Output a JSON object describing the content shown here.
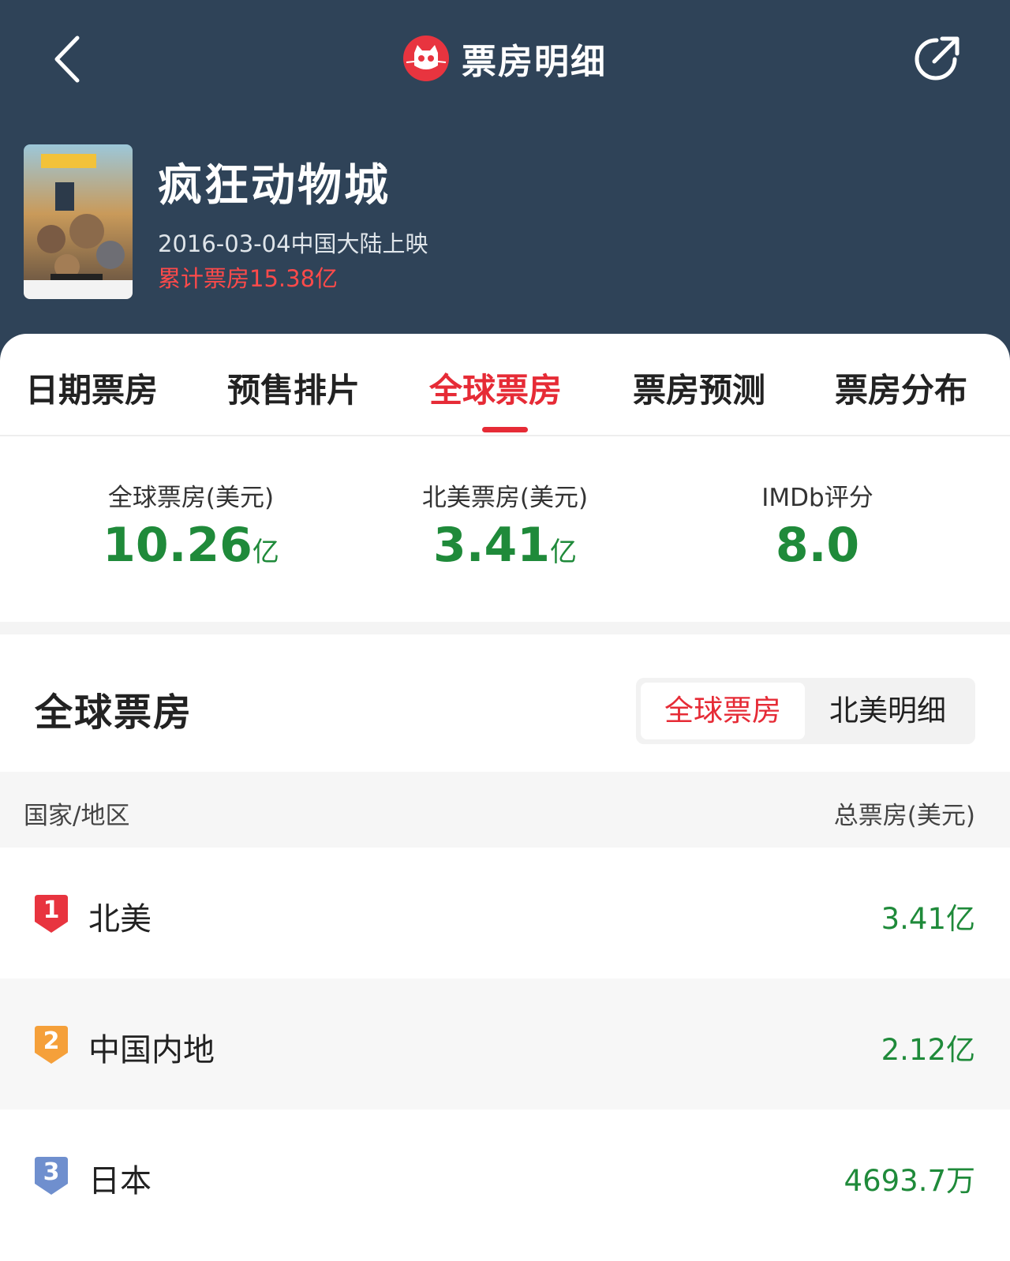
{
  "header": {
    "title": "票房明细",
    "movie_name": "疯狂动物城",
    "release_info": "2016-03-04中国大陆上映",
    "cumulative": "累计票房15.38亿"
  },
  "tabs": [
    {
      "label": "日期票房",
      "active": false
    },
    {
      "label": "预售排片",
      "active": false
    },
    {
      "label": "全球票房",
      "active": true
    },
    {
      "label": "票房预测",
      "active": false
    },
    {
      "label": "票房分布",
      "active": false
    }
  ],
  "stats": [
    {
      "label": "全球票房(美元)",
      "value": "10.26",
      "unit": "亿"
    },
    {
      "label": "北美票房(美元)",
      "value": "3.41",
      "unit": "亿"
    },
    {
      "label": "IMDb评分",
      "value": "8.0",
      "unit": ""
    }
  ],
  "section": {
    "title": "全球票房",
    "toggle_active": "全球票房",
    "toggle_other": "北美明细"
  },
  "table": {
    "col_region": "国家/地区",
    "col_total": "总票房(美元)",
    "rows": [
      {
        "rank": "1",
        "region": "北美",
        "amount": "3.41亿",
        "badge_color": "#e8343f"
      },
      {
        "rank": "2",
        "region": "中国内地",
        "amount": "2.12亿",
        "badge_color": "#f5a03a"
      },
      {
        "rank": "3",
        "region": "日本",
        "amount": "4693.7万",
        "badge_color": "#6f8fce"
      }
    ]
  },
  "colors": {
    "header_bg": "#2f4358",
    "accent_red": "#e62b36",
    "value_green": "#1f8a3a"
  }
}
